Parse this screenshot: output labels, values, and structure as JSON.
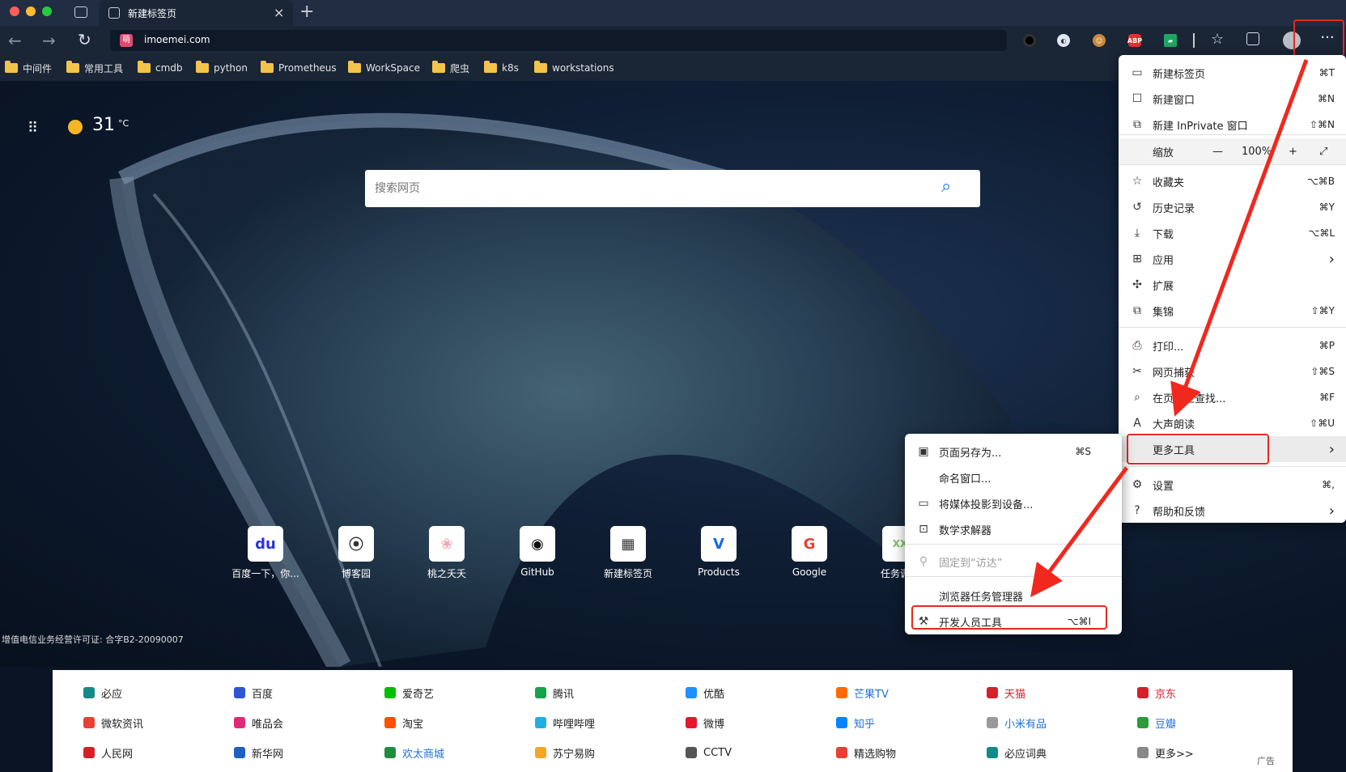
{
  "tab": {
    "title": "新建标签页",
    "close": "×",
    "new_tab": "+"
  },
  "address": {
    "url": "imoemei.com",
    "site_icon": "萌"
  },
  "extensions": [
    "record-icon",
    "globe-icon",
    "face-icon",
    "abp-icon",
    "sheets-icon"
  ],
  "bookmarks": [
    "中间件",
    "常用工具",
    "cmdb",
    "python",
    "Prometheus",
    "WorkSpace",
    "爬虫",
    "k8s",
    "workstations"
  ],
  "weather": {
    "temp": "31",
    "unit": "°C"
  },
  "search": {
    "placeholder": "搜索网页"
  },
  "tiles": [
    {
      "label": "百度一下，你...",
      "icon": "du",
      "color": "#2932e1"
    },
    {
      "label": "博客园",
      "icon": "⦿",
      "color": "#333333"
    },
    {
      "label": "桃之夭夭",
      "icon": "❀",
      "color": "#f2a6b8"
    },
    {
      "label": "GitHub",
      "icon": "◉",
      "color": "#111111"
    },
    {
      "label": "新建标签页",
      "icon": "▦",
      "color": "#333333"
    },
    {
      "label": "Products",
      "icon": "V",
      "color": "#1769e0"
    },
    {
      "label": "Google",
      "icon": "G",
      "color": "#e84234"
    },
    {
      "label": "任务调度",
      "icon": "XX",
      "color": "#7bbf6a"
    }
  ],
  "license": "增值电信业务经营许可证: 合字B2-20090007",
  "links": {
    "rows": [
      [
        {
          "t": "必应",
          "c": "#222",
          "i": "#138a8a"
        },
        {
          "t": "百度",
          "c": "#222",
          "i": "#2f55d4"
        },
        {
          "t": "爱奇艺",
          "c": "#222",
          "i": "#00be06"
        },
        {
          "t": "腾讯",
          "c": "#222",
          "i": "#17a34a"
        },
        {
          "t": "优酷",
          "c": "#222",
          "i": "#1e90ff"
        },
        {
          "t": "芒果TV",
          "c": "#1e6fd9",
          "i": "#ff6a00"
        },
        {
          "t": "天猫",
          "c": "#d4202a",
          "i": "#d4202a"
        },
        {
          "t": "京东",
          "c": "#d4202a",
          "i": "#d4202a"
        }
      ],
      [
        {
          "t": "微软资讯",
          "c": "#222",
          "i": "#e84034"
        },
        {
          "t": "唯品会",
          "c": "#222",
          "i": "#e0287a"
        },
        {
          "t": "淘宝",
          "c": "#222",
          "i": "#ff5000"
        },
        {
          "t": "哔哩哔哩",
          "c": "#222",
          "i": "#23ade5"
        },
        {
          "t": "微博",
          "c": "#222",
          "i": "#e6162d"
        },
        {
          "t": "知乎",
          "c": "#1e6fd9",
          "i": "#0084ff"
        },
        {
          "t": "小米有品",
          "c": "#1e6fd9",
          "i": "#999999"
        },
        {
          "t": "豆瓣",
          "c": "#1e6fd9",
          "i": "#2f9a3a"
        }
      ],
      [
        {
          "t": "人民网",
          "c": "#222",
          "i": "#d4202a"
        },
        {
          "t": "新华网",
          "c": "#222",
          "i": "#1f5fbf"
        },
        {
          "t": "欢太商城",
          "c": "#1e6fd9",
          "i": "#1e8e3e"
        },
        {
          "t": "苏宁易购",
          "c": "#222",
          "i": "#f5a623"
        },
        {
          "t": "CCTV",
          "c": "#222",
          "i": "#555555"
        },
        {
          "t": "精选购物",
          "c": "#222",
          "i": "#e84034"
        },
        {
          "t": "必应词典",
          "c": "#222",
          "i": "#138a8a"
        },
        {
          "t": "更多>>",
          "c": "#222",
          "i": "#888888"
        }
      ]
    ],
    "ad": "广告"
  },
  "main_menu": {
    "items": [
      {
        "label": "新建标签页",
        "shortcut": "⌘T",
        "icon": "new-tab-icon",
        "glyph": "▭"
      },
      {
        "label": "新建窗口",
        "shortcut": "⌘N",
        "icon": "window-icon",
        "glyph": "☐"
      },
      {
        "label": "新建 InPrivate 窗口",
        "shortcut": "⇧⌘N",
        "icon": "inprivate-icon",
        "glyph": "⧉"
      },
      {
        "label": "缩放",
        "shortcut": "",
        "icon": "zoom-icon",
        "glyph": ""
      },
      {
        "label": "收藏夹",
        "shortcut": "⌥⌘B",
        "icon": "favorites-icon",
        "glyph": "☆"
      },
      {
        "label": "历史记录",
        "shortcut": "⌘Y",
        "icon": "history-icon",
        "glyph": "↺"
      },
      {
        "label": "下载",
        "shortcut": "⌥⌘L",
        "icon": "download-icon",
        "glyph": "⤓"
      },
      {
        "label": "应用",
        "shortcut": "",
        "icon": "apps-icon",
        "glyph": "⊞"
      },
      {
        "label": "扩展",
        "shortcut": "",
        "icon": "extensions-icon",
        "glyph": "✣"
      },
      {
        "label": "集锦",
        "shortcut": "⇧⌘Y",
        "icon": "collections-icon",
        "glyph": "⧉"
      },
      {
        "label": "打印...",
        "shortcut": "⌘P",
        "icon": "print-icon",
        "glyph": "⎙"
      },
      {
        "label": "网页捕获",
        "shortcut": "⇧⌘S",
        "icon": "capture-icon",
        "glyph": "✂"
      },
      {
        "label": "在页面上查找...",
        "shortcut": "⌘F",
        "icon": "find-icon",
        "glyph": "⌕"
      },
      {
        "label": "大声朗读",
        "shortcut": "⇧⌘U",
        "icon": "read-aloud-icon",
        "glyph": "A"
      },
      {
        "label": "更多工具",
        "shortcut": "",
        "icon": "more-tools-icon",
        "glyph": ""
      },
      {
        "label": "设置",
        "shortcut": "⌘,",
        "icon": "settings-icon",
        "glyph": "⚙"
      },
      {
        "label": "帮助和反馈",
        "shortcut": "",
        "icon": "help-icon",
        "glyph": "?"
      }
    ],
    "zoom": {
      "minus": "—",
      "value": "100%",
      "plus": "+",
      "full": "⤢"
    }
  },
  "sub_menu": {
    "items": [
      {
        "label": "页面另存为...",
        "shortcut": "⌘S",
        "icon": "save-icon",
        "glyph": "▣"
      },
      {
        "label": "命名窗口...",
        "shortcut": "",
        "icon": "",
        "glyph": ""
      },
      {
        "label": "将媒体投影到设备...",
        "shortcut": "",
        "icon": "cast-icon",
        "glyph": "▭"
      },
      {
        "label": "数学求解器",
        "shortcut": "",
        "icon": "math-icon",
        "glyph": "⊡"
      },
      {
        "label": "固定到“访达”",
        "shortcut": "",
        "icon": "pin-icon",
        "glyph": "⚲"
      },
      {
        "label": "浏览器任务管理器",
        "shortcut": "",
        "icon": "",
        "glyph": ""
      },
      {
        "label": "开发人员工具",
        "shortcut": "⌥⌘I",
        "icon": "devtools-icon",
        "glyph": "⚒"
      }
    ]
  }
}
